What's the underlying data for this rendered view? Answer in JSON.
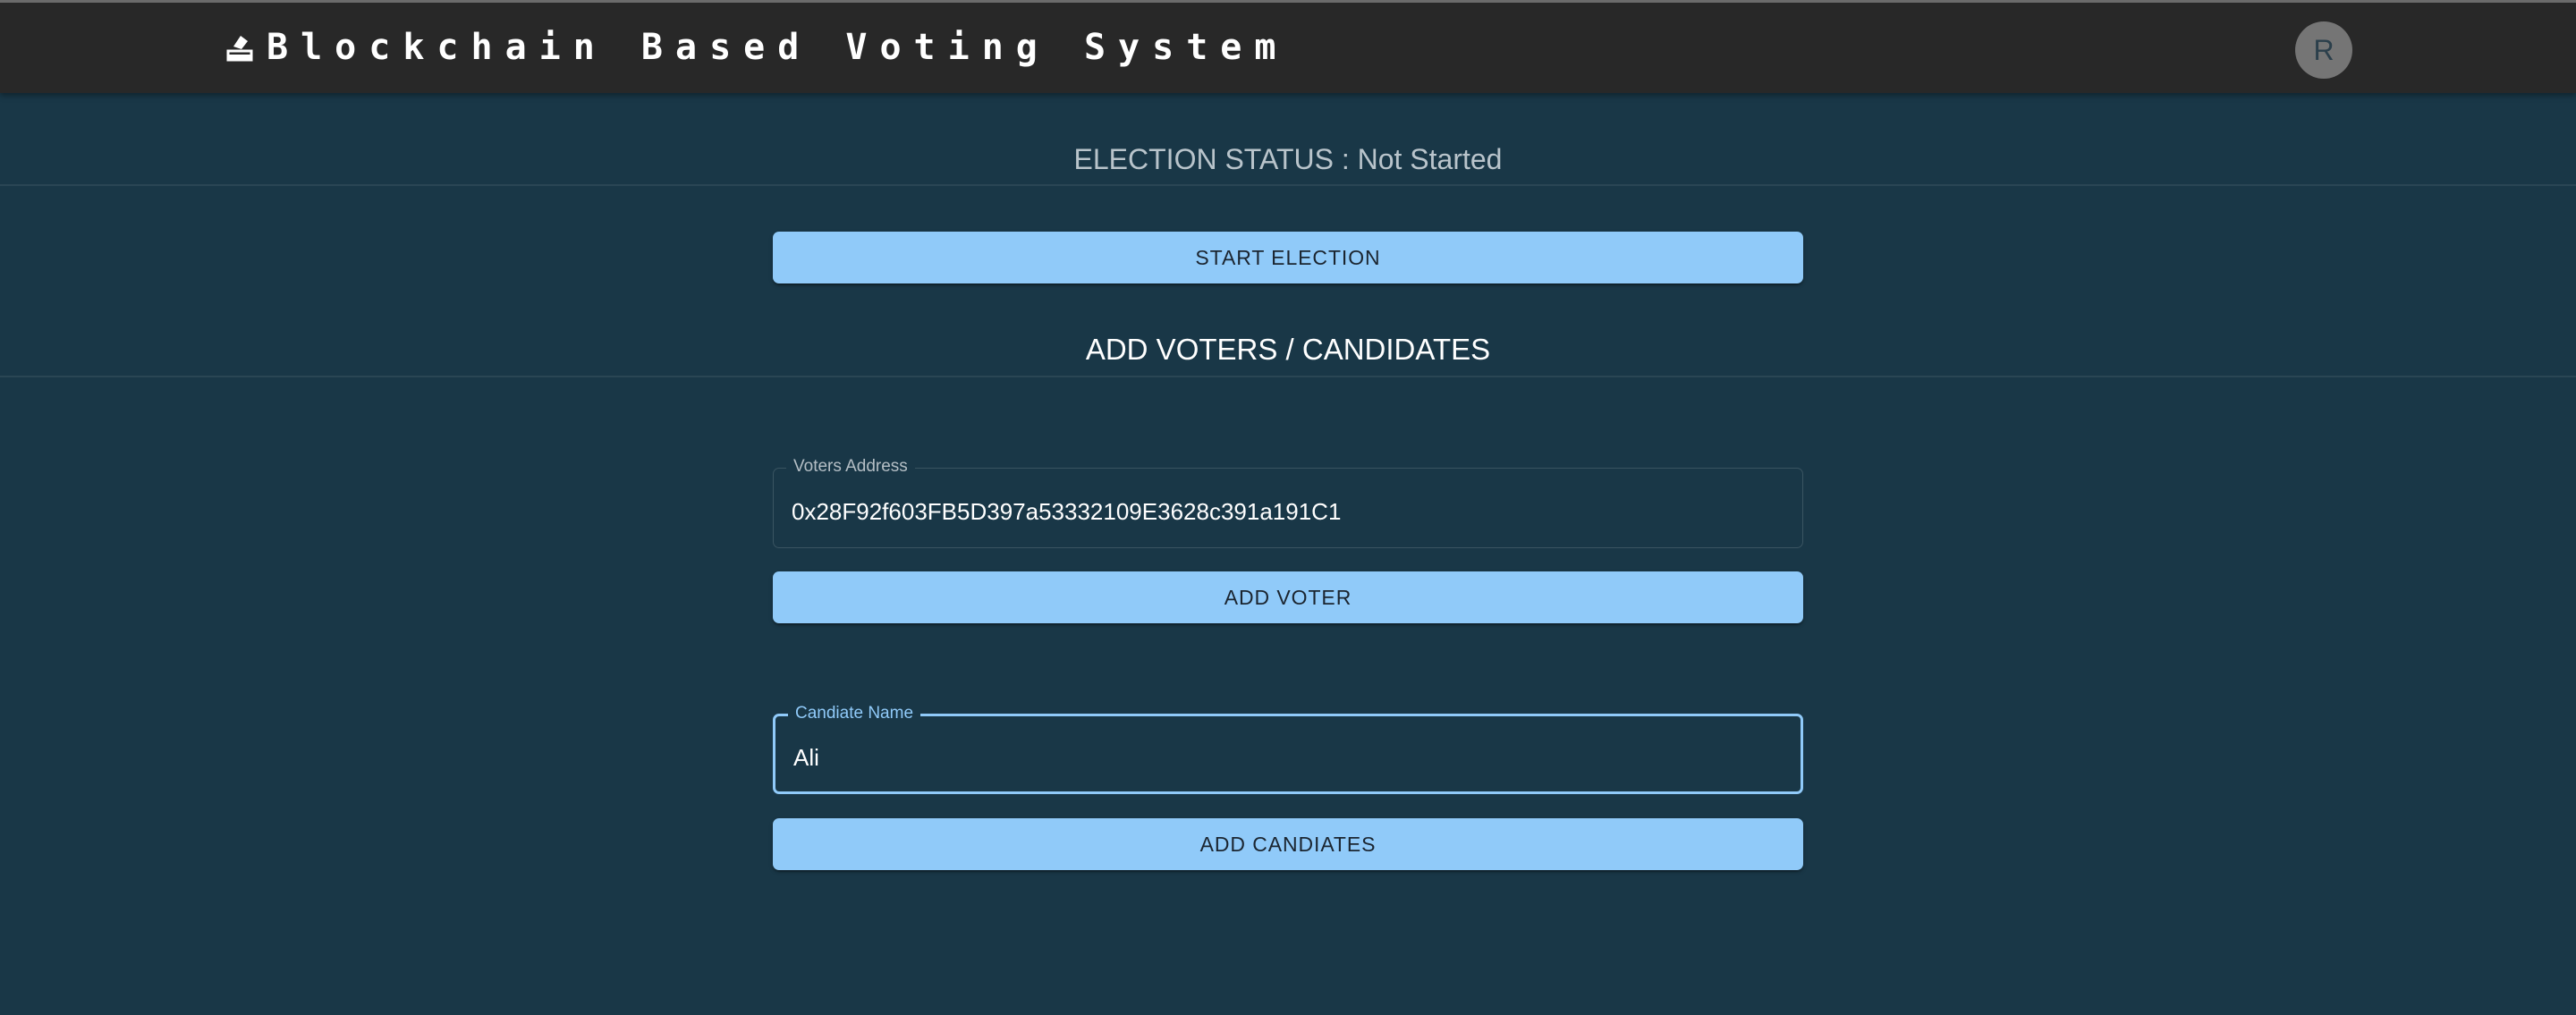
{
  "appbar": {
    "title": "Blockchain Based Voting System",
    "logo_icon": "ballot-box-icon",
    "avatar_initial": "R"
  },
  "election": {
    "status_text": "ELECTION STATUS : Not Started",
    "start_button_label": "START ELECTION"
  },
  "add_section": {
    "title": "ADD VOTERS / CANDIDATES",
    "voter_field": {
      "label": "Voters Address",
      "value": "0x28F92f603FB5D397a53332109E3628c391a191C1"
    },
    "add_voter_label": "ADD VOTER",
    "candidate_field": {
      "label": "Candiate Name",
      "value": "Ali"
    },
    "add_candidate_label": "ADD CANDIATES"
  },
  "colors": {
    "background": "#193747",
    "appbar": "#282828",
    "primary": "#90caf9",
    "avatar": "#757575"
  }
}
